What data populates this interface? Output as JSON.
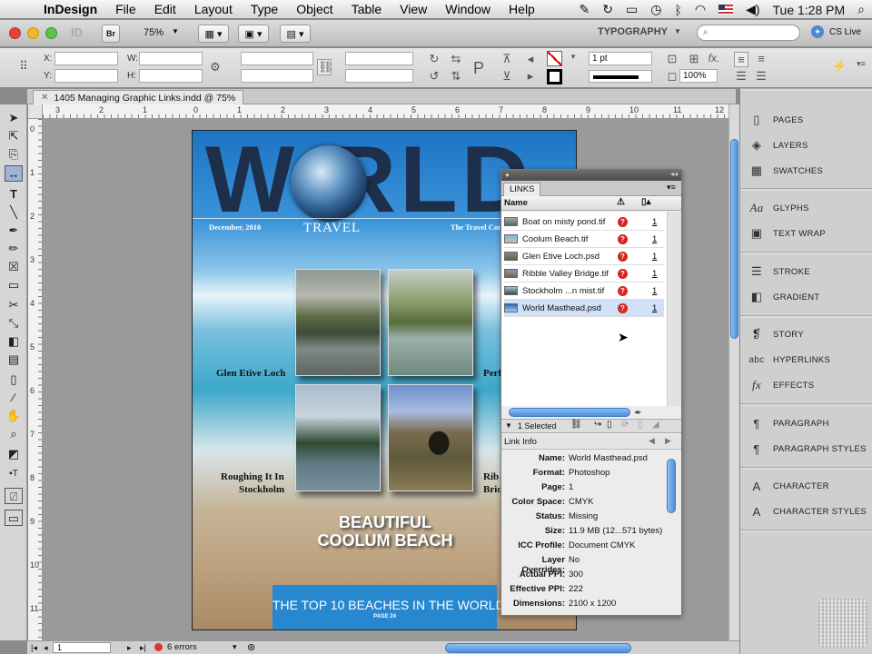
{
  "menubar": {
    "app": "InDesign",
    "items": [
      "File",
      "Edit",
      "Layout",
      "Type",
      "Object",
      "Table",
      "View",
      "Window",
      "Help"
    ],
    "clock": "Tue 1:28 PM"
  },
  "appbar": {
    "zoom": "75%",
    "workspace": "TYPOGRAPHY",
    "search_placeholder": "",
    "cs_live": "CS Live",
    "br_label": "Br"
  },
  "control": {
    "x_label": "X:",
    "y_label": "Y:",
    "w_label": "W:",
    "h_label": "H:",
    "stroke_weight": "1 pt",
    "scale": "100%"
  },
  "document": {
    "tab_title": "1405 Managing Graphic Links.indd @ 75%"
  },
  "rulers": {
    "h": [
      "3",
      "2",
      "1",
      "0",
      "1",
      "2",
      "3",
      "4",
      "5",
      "6",
      "7",
      "8",
      "9",
      "10",
      "11",
      "12"
    ],
    "v": [
      "0",
      "1",
      "2",
      "3",
      "4",
      "5",
      "6",
      "7",
      "8",
      "9",
      "10",
      "11",
      "12"
    ]
  },
  "page": {
    "masthead": "W  RLD",
    "date": "December, 2010",
    "travel": "TRAVEL",
    "tagline": "The Travel Com",
    "captions": [
      "Glen Etive Loch",
      "Perf",
      "Roughing It In",
      "Stockholm",
      "Rib",
      "Brid"
    ],
    "headline1": "BEAUTIFUL",
    "headline2": "COOLUM BEACH",
    "banner": "THE TOP 10 BEACHES IN THE WORLD",
    "banner_sub": "PAGE 24"
  },
  "status": {
    "page": "1",
    "errors": "6 errors"
  },
  "dock": [
    {
      "label": "PAGES",
      "icon": "pages-icon"
    },
    {
      "label": "LAYERS",
      "icon": "layers-icon"
    },
    {
      "label": "SWATCHES",
      "icon": "swatches-icon"
    },
    {
      "label": "GLYPHS",
      "icon": "glyphs-icon"
    },
    {
      "label": "TEXT WRAP",
      "icon": "text-wrap-icon"
    },
    {
      "label": "STROKE",
      "icon": "stroke-icon"
    },
    {
      "label": "GRADIENT",
      "icon": "gradient-icon"
    },
    {
      "label": "STORY",
      "icon": "story-icon"
    },
    {
      "label": "HYPERLINKS",
      "icon": "hyperlinks-icon"
    },
    {
      "label": "EFFECTS",
      "icon": "effects-icon"
    },
    {
      "label": "PARAGRAPH",
      "icon": "paragraph-icon"
    },
    {
      "label": "PARAGRAPH STYLES",
      "icon": "paragraph-styles-icon"
    },
    {
      "label": "CHARACTER",
      "icon": "character-icon"
    },
    {
      "label": "CHARACTER STYLES",
      "icon": "character-styles-icon"
    }
  ],
  "links": {
    "tab": "LINKS",
    "col_name": "Name",
    "rows": [
      {
        "name": "Boat on misty pond.tif",
        "page": "1"
      },
      {
        "name": "Coolum Beach.tif",
        "page": "1"
      },
      {
        "name": "Glen Etive Loch.psd",
        "page": "1"
      },
      {
        "name": "Ribble Valley Bridge.tif",
        "page": "1"
      },
      {
        "name": "Stockholm ...n mist.tif",
        "page": "1"
      },
      {
        "name": "World Masthead.psd",
        "page": "1"
      }
    ],
    "selected_count": "1 Selected",
    "info_title": "Link Info",
    "info": [
      {
        "k": "Name:",
        "v": "World Masthead.psd"
      },
      {
        "k": "Format:",
        "v": "Photoshop"
      },
      {
        "k": "Page:",
        "v": "1"
      },
      {
        "k": "Color Space:",
        "v": "CMYK"
      },
      {
        "k": "Status:",
        "v": "Missing"
      },
      {
        "k": "Size:",
        "v": "11.9 MB (12...571 bytes)"
      },
      {
        "k": "ICC Profile:",
        "v": "Document CMYK"
      },
      {
        "k": "Layer Overrides:",
        "v": "No"
      },
      {
        "k": "Actual PPI:",
        "v": "300"
      },
      {
        "k": "Effective PPI:",
        "v": "222"
      },
      {
        "k": "Dimensions:",
        "v": "2100 x 1200"
      }
    ]
  }
}
